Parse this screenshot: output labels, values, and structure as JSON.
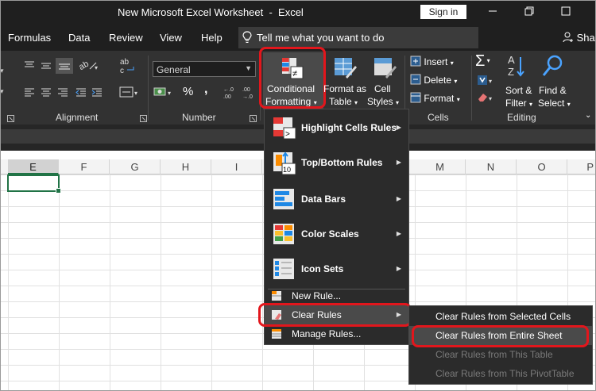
{
  "window": {
    "title": "New Microsoft Excel Worksheet  -  Excel",
    "sign_in": "Sign in",
    "minimize_icon": "minimize-icon",
    "restore_icon": "restore-icon",
    "close_icon": "close-icon"
  },
  "tabs": [
    "Formulas",
    "Data",
    "Review",
    "View",
    "Help"
  ],
  "tell_me": {
    "placeholder": "Tell me what you want to do",
    "icon": "lightbulb-icon"
  },
  "share_label": "Sha",
  "ribbon": {
    "groups": {
      "alignment": "Alignment",
      "number": "Number",
      "cells": "Cells",
      "editing": "Editing"
    },
    "number_format": "General",
    "alignment_icons": [
      "align-top-icon",
      "align-middle-icon",
      "align-bottom-icon",
      "orientation-icon",
      "wrap-text-icon",
      "align-left-icon",
      "align-center-icon",
      "align-right-icon",
      "decrease-indent-icon",
      "increase-indent-icon",
      "merge-center-icon"
    ],
    "number_buttons": {
      "percent": "%",
      "comma": ","
    },
    "number_icons": [
      "accounting-format-icon",
      "increase-decimal-icon",
      "decrease-decimal-icon"
    ],
    "styles": {
      "conditional_formatting": [
        "Conditional",
        "Formatting"
      ],
      "format_as_table": [
        "Format as",
        "Table"
      ],
      "cell_styles": [
        "Cell",
        "Styles"
      ]
    },
    "cells": {
      "insert": "Insert",
      "delete": "Delete",
      "format": "Format"
    },
    "editing": {
      "sort_filter": [
        "Sort &",
        "Filter"
      ],
      "find_select": [
        "Find &",
        "Select"
      ]
    }
  },
  "columns": [
    "E",
    "F",
    "G",
    "H",
    "I",
    "M",
    "N",
    "O",
    "P"
  ],
  "selected_column": "E",
  "cf_menu": {
    "items": [
      {
        "label": "Highlight Cells Rules",
        "icon": "highlight-cells-rules-icon",
        "submenu": true
      },
      {
        "label": "Top/Bottom Rules",
        "icon": "top-bottom-rules-icon",
        "submenu": true
      },
      {
        "label": "Data Bars",
        "icon": "data-bars-icon",
        "submenu": true
      },
      {
        "label": "Color Scales",
        "icon": "color-scales-icon",
        "submenu": true
      },
      {
        "label": "Icon Sets",
        "icon": "icon-sets-icon",
        "submenu": true
      }
    ],
    "actions": [
      {
        "label": "New Rule...",
        "icon": "new-rule-icon"
      },
      {
        "label": "Clear Rules",
        "icon": "clear-rules-icon",
        "submenu": true
      },
      {
        "label": "Manage Rules...",
        "icon": "manage-rules-icon"
      }
    ]
  },
  "clear_submenu": [
    {
      "label": "Clear Rules from Selected Cells",
      "enabled": true
    },
    {
      "label": "Clear Rules from Entire Sheet",
      "enabled": true
    },
    {
      "label": "Clear Rules from This Table",
      "enabled": false
    },
    {
      "label": "Clear Rules from This PivotTable",
      "enabled": false
    }
  ],
  "colors": {
    "titlebar": "#1f1f1f",
    "ribbon": "#323232",
    "menu": "#2b2b2b",
    "highlight": "#e2161c",
    "excel_green": "#217346"
  }
}
